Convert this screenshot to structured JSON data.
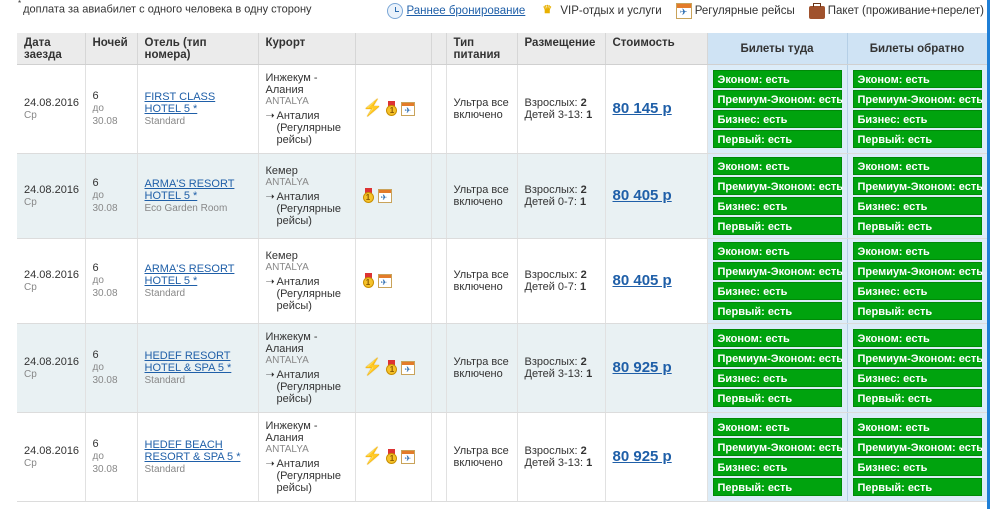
{
  "note": {
    "mark": "*",
    "text": "доплата за авиабилет с одного человека в одну сторону"
  },
  "toplinks": [
    {
      "icon": "clock-icon",
      "label": "Раннее бронирование",
      "link": true
    },
    {
      "icon": "vip-icon",
      "label": "VIP-отдых и услуги",
      "link": false
    },
    {
      "icon": "calendar-plane-icon",
      "label": "Регулярные рейсы",
      "link": false
    },
    {
      "icon": "suitcase-icon",
      "label": "Пакет (проживание+перелет)",
      "link": false
    }
  ],
  "headers": {
    "date": "Дата заезда",
    "nights": "Ночей",
    "hotel": "Отель (тип номера)",
    "resort": "Курорт",
    "meal": "Тип питания",
    "placement": "Размещение",
    "price": "Стоимость",
    "to": "Билеты туда",
    "back": "Билеты обратно"
  },
  "rows": [
    {
      "date": "24.08.2016",
      "dow": "Ср",
      "nights": "6",
      "until": "до 30.08",
      "hotel": "FIRST CLASS HOTEL 5 *",
      "room": "Standard",
      "resort": "Инжекум - Алания",
      "region": "ANTALYA",
      "flight": "Анталия (Регулярные рейсы)",
      "bolt": true,
      "meal": "Ультра все включено",
      "adults_label": "Взрослых:",
      "adults": "2",
      "kids_label": "Детей 3-13:",
      "kids": "1",
      "price": "80 145 р"
    },
    {
      "date": "24.08.2016",
      "dow": "Ср",
      "nights": "6",
      "until": "до 30.08",
      "hotel": "ARMA'S RESORT HOTEL 5 *",
      "room": "Eco Garden Room",
      "resort": "Кемер",
      "region": "ANTALYA",
      "flight": "Анталия (Регулярные рейсы)",
      "bolt": false,
      "meal": "Ультра все включено",
      "adults_label": "Взрослых:",
      "adults": "2",
      "kids_label": "Детей 0-7:",
      "kids": "1",
      "price": "80 405 р"
    },
    {
      "date": "24.08.2016",
      "dow": "Ср",
      "nights": "6",
      "until": "до 30.08",
      "hotel": "ARMA'S RESORT HOTEL 5 *",
      "room": "Standard",
      "resort": "Кемер",
      "region": "ANTALYA",
      "flight": "Анталия (Регулярные рейсы)",
      "bolt": false,
      "meal": "Ультра все включено",
      "adults_label": "Взрослых:",
      "adults": "2",
      "kids_label": "Детей 0-7:",
      "kids": "1",
      "price": "80 405 р"
    },
    {
      "date": "24.08.2016",
      "dow": "Ср",
      "nights": "6",
      "until": "до 30.08",
      "hotel": "HEDEF RESORT HOTEL & SPA 5 *",
      "room": "Standard",
      "resort": "Инжекум - Алания",
      "region": "ANTALYA",
      "flight": "Анталия (Регулярные рейсы)",
      "bolt": true,
      "meal": "Ультра все включено",
      "adults_label": "Взрослых:",
      "adults": "2",
      "kids_label": "Детей 3-13:",
      "kids": "1",
      "price": "80 925 р"
    },
    {
      "date": "24.08.2016",
      "dow": "Ср",
      "nights": "6",
      "until": "до 30.08",
      "hotel": "HEDEF BEACH RESORT & SPA 5 *",
      "room": "Standard",
      "resort": "Инжекум - Алания",
      "region": "ANTALYA",
      "flight": "Анталия (Регулярные рейсы)",
      "bolt": true,
      "meal": "Ультра все включено",
      "adults_label": "Взрослых:",
      "adults": "2",
      "kids_label": "Детей 3-13:",
      "kids": "1",
      "price": "80 925 р"
    }
  ],
  "tickets": [
    {
      "cls": "Эконом:",
      "status": "есть"
    },
    {
      "cls": "Премиум-Эконом:",
      "status": "есть"
    },
    {
      "cls": "Бизнес:",
      "status": "есть"
    },
    {
      "cls": "Первый:",
      "status": "есть"
    }
  ],
  "colors": {
    "ticket_green": "#00a30e",
    "link_blue": "#1f5fa8",
    "tickets_bg": "#dcecf8"
  }
}
